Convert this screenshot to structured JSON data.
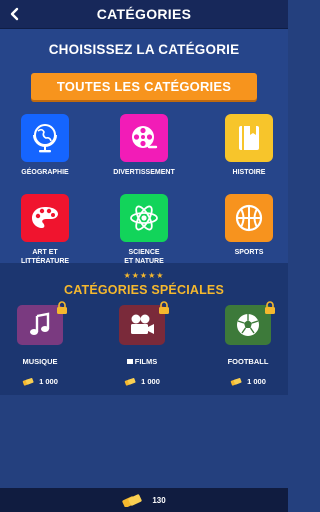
{
  "header": {
    "title": "CATÉGORIES",
    "back_icon": "chevron-left-icon"
  },
  "main": {
    "heading": "CHOISISSEZ LA CATÉGORIE",
    "all_categories_label": "TOUTES LES CATÉGORIES",
    "categories": [
      {
        "label": "GÉOGRAPHIE",
        "icon": "globe-icon",
        "color": "#1565ff"
      },
      {
        "label": "DIVERTISSEMENT",
        "icon": "film-reel-icon",
        "color": "#f21cb7"
      },
      {
        "label": "HISTOIRE",
        "icon": "book-icon",
        "color": "#f7c52b"
      },
      {
        "label_line1": "ART ET",
        "label_line2": "LITTÉRATURE",
        "icon": "palette-icon",
        "color": "#f0142e"
      },
      {
        "label_line1": "SCIENCE",
        "label_line2": "ET NATURE",
        "icon": "atom-icon",
        "color": "#12d45a"
      },
      {
        "label": "SPORTS",
        "icon": "basketball-icon",
        "color": "#f7931e"
      }
    ]
  },
  "special": {
    "stars": "★★★★★",
    "title": "CATÉGORIES SPÉCIALES",
    "items": [
      {
        "label": "MUSIQUE",
        "icon": "music-note-icon",
        "color": "#7a3a80",
        "price": "1 000"
      },
      {
        "label": "FILMS",
        "icon": "film-camera-icon",
        "color": "#7a2a3a",
        "price": "1 000"
      },
      {
        "label": "FOOTBALL",
        "icon": "soccer-ball-icon",
        "color": "#3d7a3a",
        "price": "1 000"
      }
    ]
  },
  "footer": {
    "coins": "130",
    "coin_icon": "coins-icon"
  }
}
